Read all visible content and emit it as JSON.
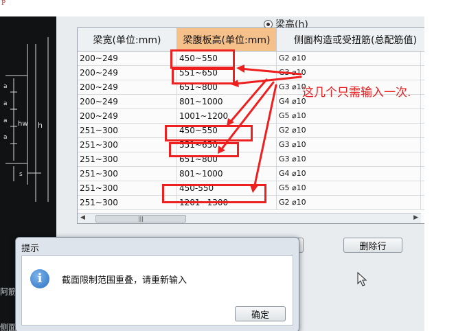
{
  "corner_mark": "P",
  "radio_options": [
    {
      "label": "梁高(h)",
      "checked": true
    }
  ],
  "table": {
    "headers": [
      "梁宽(单位:mm)",
      "梁腹板高(单位:mm)",
      "侧面构造或受扭筋(总配筋值)"
    ],
    "rows": [
      [
        "200~249",
        "450~550",
        "G2 ⌀10"
      ],
      [
        "200~249",
        "551~650",
        "G3 ⌀10"
      ],
      [
        "200~249",
        "651~800",
        "G3 ⌀10"
      ],
      [
        "200~249",
        "801~1000",
        "G4 ⌀10"
      ],
      [
        "200~249",
        "1001~1200",
        "G5 ⌀10"
      ],
      [
        "251~300",
        "450~550",
        "G2 ⌀10"
      ],
      [
        "251~300",
        "551~650",
        "G3 ⌀10"
      ],
      [
        "251~300",
        "651~800",
        "G3 ⌀10"
      ],
      [
        "251~300",
        "801~1000",
        "G4 ⌀10"
      ],
      [
        "251~300",
        "450-550",
        "G5 ⌀10"
      ],
      [
        "251~300",
        "1201~1300",
        "G2 ⌀10"
      ]
    ]
  },
  "annotation": "这几个只需输入一次.",
  "buttons": {
    "delete_row": "删除行"
  },
  "dialog": {
    "title": "提示",
    "message": "截面限制范围重叠，请重新输入",
    "ok": "确定"
  },
  "cad_labels": [
    "a",
    "a",
    "a",
    "a",
    "hw",
    "h",
    "s"
  ],
  "background_text": [
    "阿筋信",
    "侧面纵筋"
  ],
  "colors": {
    "annotation_red": "#ee1f1f",
    "selected_header": "#f6c08a",
    "info_icon": "#2a6fc2"
  },
  "icons": [
    "info-icon",
    "mouse-cursor-icon"
  ]
}
